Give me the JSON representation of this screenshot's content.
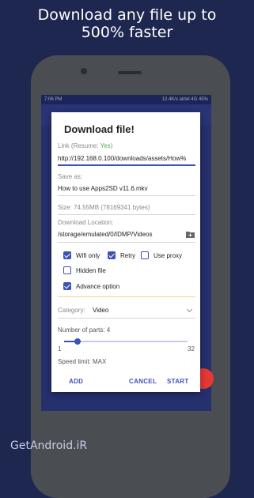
{
  "promo": {
    "headline_line1": "Download any file up to",
    "headline_line2": "500% faster",
    "watermark": "GetAndroid.iR"
  },
  "statusbar": {
    "time": "7:06 PM",
    "right": "12.4K/s  airtel 4G  45%"
  },
  "dialog": {
    "title": "Download file!",
    "link_label": "Link (Resume: ",
    "link_resume_value": "Yes",
    "link_label_end": ")",
    "link_value": "http://192.168.0.100/downloads/assets/How%",
    "save_as_label": "Save as:",
    "save_as_value": "How to use Apps2SD v11.6.mkv",
    "size_text": "Size: 74.55MB (78169341 bytes)",
    "location_label": "Download Location:",
    "location_value": "/storage/emulated/0/IDMP/Videos",
    "options": {
      "wifi_only": {
        "label": "Wifi only",
        "checked": true
      },
      "retry": {
        "label": "Retry",
        "checked": true
      },
      "use_proxy": {
        "label": "Use proxy",
        "checked": false
      },
      "hidden_file": {
        "label": "Hidden file",
        "checked": false
      },
      "advance_option": {
        "label": "Advance option",
        "checked": true
      }
    },
    "category_label": "Category:",
    "category_value": "Video",
    "parts_label": "Number of parts: 4",
    "parts_current": 4,
    "parts_min": "1",
    "parts_max": "32",
    "speed_limit": "Speed limit: MAX",
    "buttons": {
      "add": "ADD",
      "cancel": "CANCEL",
      "start": "START"
    }
  },
  "colors": {
    "accent": "#3f51b5",
    "resume_yes": "#4caf50",
    "background": "#1e2750"
  }
}
